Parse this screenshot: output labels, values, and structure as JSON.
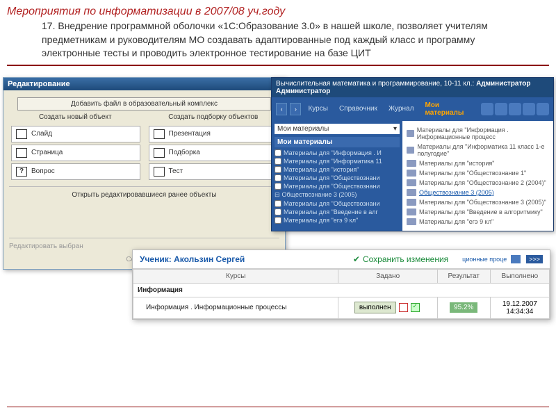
{
  "header": {
    "title": "Мероприятия по информатизации  в 2007/08 уч.году",
    "body": "17. Внедрение программной оболочки «1С:Образование 3.0» в нашей школе, позволяет учителям предметникам и руководителям МО создавать  адаптированные под каждый класс и программу электронные тесты и проводить  электронное тестирование на базе ЦИТ"
  },
  "win1": {
    "title": "Редактирование",
    "add_file": "Добавить файл в образовательный комплекс",
    "create_new": "Создать новый объект",
    "create_coll": "Создать подборку объектов",
    "objs": {
      "slide": "Слайд",
      "page": "Страница",
      "question": "Вопрос",
      "presentation": "Презентация",
      "collection": "Подборка",
      "test": "Тест"
    },
    "open_prev": "Открыть редактировавшиеся ранее объекты",
    "edit_sel": "Редактировать выбран",
    "create_or": "Создать ил"
  },
  "win2": {
    "title_suffix": "Вычислительная математика и программирование, 10-11 кл.:",
    "admin": "Администратор Администратор",
    "tabs": {
      "courses": "Курсы",
      "ref": "Справочник",
      "journal": "Журнал",
      "mine": "Мои материалы"
    },
    "dd": "Мои материалы",
    "panel": "Мои материалы",
    "left_items": [
      "Материалы для \"Информация . И",
      "Материалы для \"Информатика 11",
      "Материалы для \"история\"",
      "Материалы для \"Обществознани",
      "Материалы для \"Обществознани",
      "Обществознание 3 (2005)",
      "Материалы для \"Обществознани",
      "Материалы для \"Введение в алг",
      "Материалы для \"егэ 9 кл\""
    ],
    "right_items": [
      {
        "t": "Материалы для \"Информация . Информационные процесс",
        "sel": false
      },
      {
        "t": "Материалы для \"Информатика 11 класс 1-е полугодие\"",
        "sel": false
      },
      {
        "t": "Материалы для \"история\"",
        "sel": false
      },
      {
        "t": "Материалы для \"Обществознание 1\"",
        "sel": false
      },
      {
        "t": "Материалы для \"Обществознание 2 (2004)\"",
        "sel": false
      },
      {
        "t": "Обществознание 3 (2005)",
        "sel": true
      },
      {
        "t": "Материалы для \"Обществознание 3 (2005)\"",
        "sel": false
      },
      {
        "t": "Материалы для \"Введение в алгоритмику\"",
        "sel": false
      },
      {
        "t": "Материалы для \"егэ 9 кл\"",
        "sel": false
      }
    ],
    "trail": "ционные проце",
    "arrow": ">>>"
  },
  "win3": {
    "student_label": "Ученик:",
    "student": "Акользин Сергей",
    "save": "Сохранить изменения",
    "cols": {
      "courses": "Курсы",
      "assigned": "Задано",
      "result": "Результат",
      "done": "Выполнено"
    },
    "section": "Информация",
    "row": {
      "name": "Информация . Информационные процессы",
      "status": "выполнен",
      "pct": "95.2%",
      "date": "19.12.2007",
      "time": "14:34:34"
    }
  }
}
